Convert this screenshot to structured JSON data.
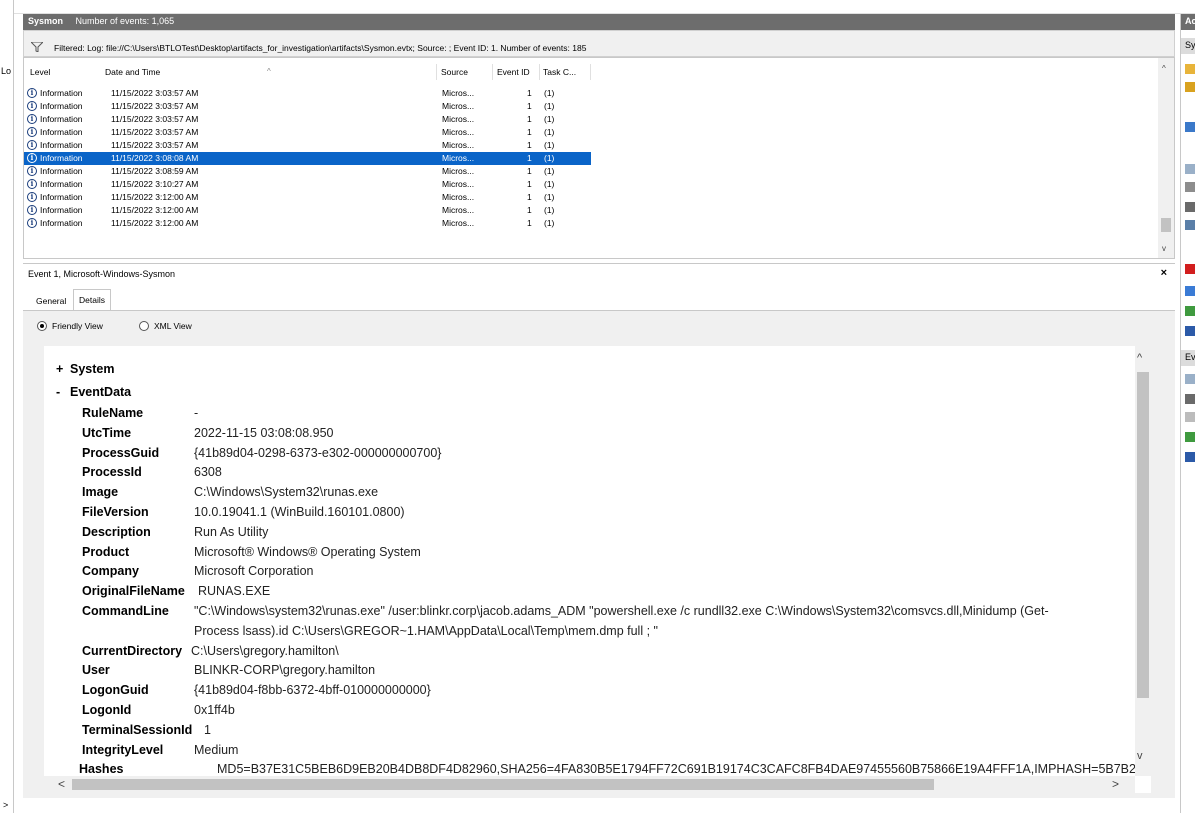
{
  "side": {
    "left_label": "Lo",
    "expand_glyph": ">"
  },
  "log": {
    "name": "Sysmon",
    "count_text": "Number of events: 1,065",
    "filter_text": "Filtered: Log: file://C:\\Users\\BTLOTest\\Desktop\\artifacts_for_investigation\\artifacts\\Sysmon.evtx; Source: ; Event ID: 1. Number of events: 185"
  },
  "grid": {
    "columns": [
      "Level",
      "Date and Time",
      "Source",
      "Event ID",
      "Task C..."
    ],
    "rows": [
      {
        "level": "Information",
        "date": "11/15/2022 3:03:57 AM",
        "source": "Micros...",
        "id": "1",
        "task": "(1)"
      },
      {
        "level": "Information",
        "date": "11/15/2022 3:03:57 AM",
        "source": "Micros...",
        "id": "1",
        "task": "(1)"
      },
      {
        "level": "Information",
        "date": "11/15/2022 3:03:57 AM",
        "source": "Micros...",
        "id": "1",
        "task": "(1)"
      },
      {
        "level": "Information",
        "date": "11/15/2022 3:03:57 AM",
        "source": "Micros...",
        "id": "1",
        "task": "(1)"
      },
      {
        "level": "Information",
        "date": "11/15/2022 3:03:57 AM",
        "source": "Micros...",
        "id": "1",
        "task": "(1)"
      },
      {
        "level": "Information",
        "date": "11/15/2022 3:08:08 AM",
        "source": "Micros...",
        "id": "1",
        "task": "(1)"
      },
      {
        "level": "Information",
        "date": "11/15/2022 3:08:59 AM",
        "source": "Micros...",
        "id": "1",
        "task": "(1)"
      },
      {
        "level": "Information",
        "date": "11/15/2022 3:10:27 AM",
        "source": "Micros...",
        "id": "1",
        "task": "(1)"
      },
      {
        "level": "Information",
        "date": "11/15/2022 3:12:00 AM",
        "source": "Micros...",
        "id": "1",
        "task": "(1)"
      },
      {
        "level": "Information",
        "date": "11/15/2022 3:12:00 AM",
        "source": "Micros...",
        "id": "1",
        "task": "(1)"
      },
      {
        "level": "Information",
        "date": "11/15/2022 3:12:00 AM",
        "source": "Micros...",
        "id": "1",
        "task": "(1)"
      }
    ],
    "selected_index": 5
  },
  "detail": {
    "title": "Event 1, Microsoft-Windows-Sysmon",
    "close_glyph": "×",
    "tabs": [
      "General",
      "Details"
    ],
    "active_tab": "Details",
    "views": [
      "Friendly View",
      "XML View"
    ],
    "selected_view": "Friendly View",
    "system_label": "System",
    "eventdata_label": "EventData",
    "expand_glyph": "+",
    "collapse_glyph": "-",
    "fields": [
      {
        "key": "RuleName",
        "value": "-"
      },
      {
        "key": "UtcTime",
        "value": "2022-11-15 03:08:08.950"
      },
      {
        "key": "ProcessGuid",
        "value": "{41b89d04-0298-6373-e302-000000000700}"
      },
      {
        "key": "ProcessId",
        "value": "6308"
      },
      {
        "key": "Image",
        "value": "C:\\Windows\\System32\\runas.exe"
      },
      {
        "key": "FileVersion",
        "value": "10.0.19041.1 (WinBuild.160101.0800)"
      },
      {
        "key": "Description",
        "value": "Run As Utility"
      },
      {
        "key": "Product",
        "value": "Microsoft® Windows® Operating System"
      },
      {
        "key": "Company",
        "value": "Microsoft Corporation"
      },
      {
        "key": "OriginalFileName",
        "value": "RUNAS.EXE"
      },
      {
        "key": "CommandLine",
        "value": "\"C:\\Windows\\system32\\runas.exe\" /user:blinkr.corp\\jacob.adams_ADM \"powershell.exe /c rundll32.exe C:\\Windows\\System32\\comsvcs.dll,Minidump (Get-",
        "value2": "Process lsass).id C:\\Users\\GREGOR~1.HAM\\AppData\\Local\\Temp\\mem.dmp full ; \""
      },
      {
        "key": "CurrentDirectory",
        "value": "C:\\Users\\gregory.hamilton\\"
      },
      {
        "key": "User",
        "value": "BLINKR-CORP\\gregory.hamilton"
      },
      {
        "key": "LogonGuid",
        "value": "{41b89d04-f8bb-6372-4bff-010000000000}"
      },
      {
        "key": "LogonId",
        "value": "0x1ff4b"
      },
      {
        "key": "TerminalSessionId",
        "value": "1"
      },
      {
        "key": "IntegrityLevel",
        "value": "Medium"
      },
      {
        "key": "Hashes",
        "value": "MD5=B37E31C5BEB6D9EB20B4DB8DF4D82960,SHA256=4FA830B5E1794FF72C691B19174C3CAFC8FB4DAE97455560B75866E19A4FFF1A,IMPHASH=5B7B2"
      }
    ]
  },
  "actions": {
    "header": "Ac",
    "sub1": "Sy",
    "sub2": "Ev"
  },
  "colors": {
    "selection": "#0a64c8",
    "header_bar": "#6d6d6d"
  }
}
